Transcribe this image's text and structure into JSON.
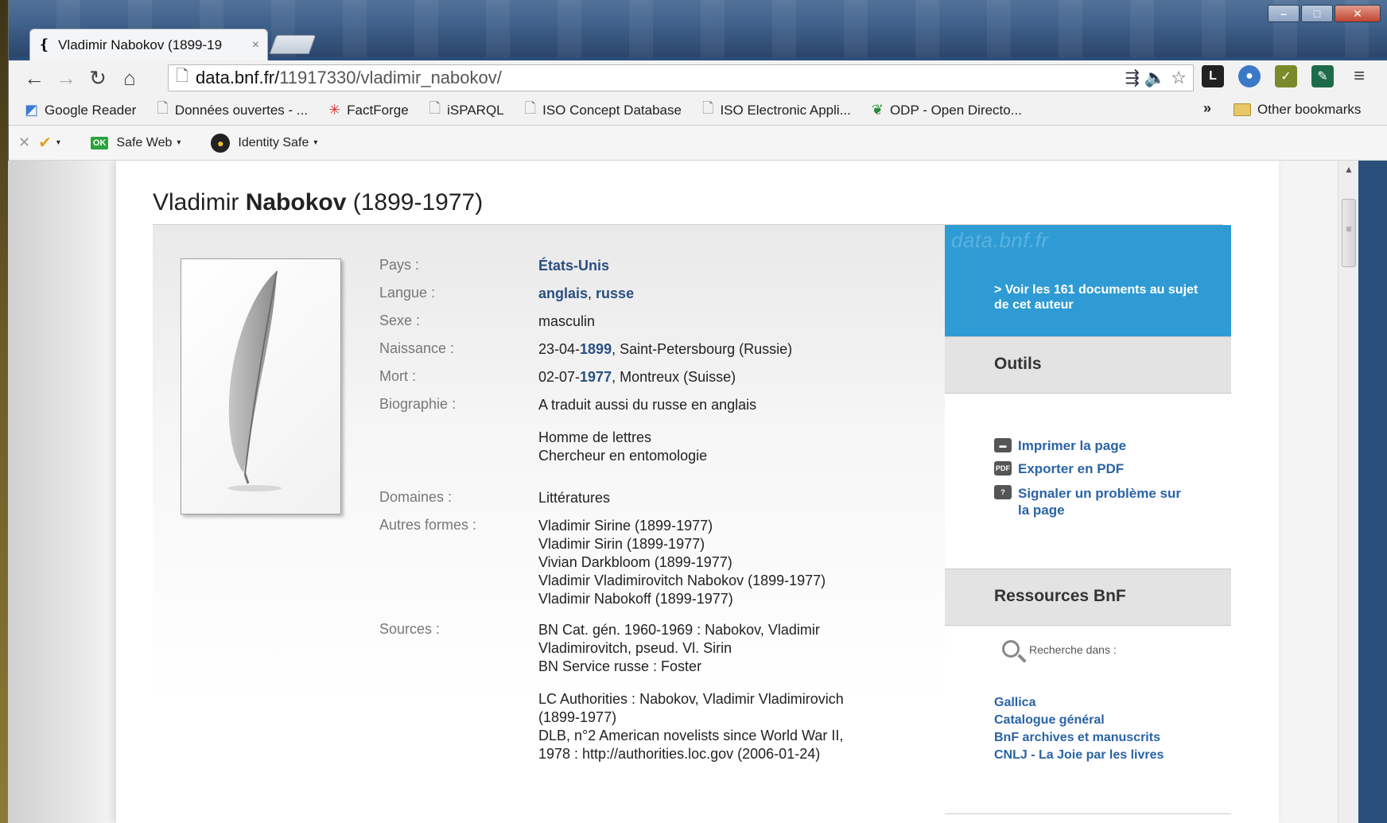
{
  "browser": {
    "tab_title": "Vladimir Nabokov (1899-19",
    "tab_close": "×",
    "url_host": "data.bnf.fr/",
    "url_path": "11917330/vladimir_nabokov/",
    "bookmarks": [
      {
        "label": "Google Reader",
        "icon": "google-icon"
      },
      {
        "label": "Données ouvertes - ...",
        "icon": "page-icon"
      },
      {
        "label": "FactForge",
        "icon": "factforge-icon"
      },
      {
        "label": "iSPARQL",
        "icon": "page-icon"
      },
      {
        "label": "ISO Concept Database",
        "icon": "page-icon"
      },
      {
        "label": "ISO Electronic Appli...",
        "icon": "page-icon"
      },
      {
        "label": "ODP - Open Directo...",
        "icon": "odp-icon"
      }
    ],
    "bookmarks_more": "»",
    "other_bookmarks": "Other bookmarks",
    "norton": {
      "safe_web": "Safe Web",
      "safe_web_badge": "OK",
      "identity_safe": "Identity Safe"
    }
  },
  "page": {
    "title_first": "Vladimir",
    "title_last": "Nabokov",
    "title_dates": "(1899-1977)",
    "fields": {
      "pays_label": "Pays :",
      "pays_value": "États-Unis",
      "langue_label": "Langue :",
      "langue_v1": "anglais",
      "langue_sep": ", ",
      "langue_v2": "russe",
      "sexe_label": "Sexe :",
      "sexe_value": "masculin",
      "naissance_label": "Naissance :",
      "naissance_day": "23-04-",
      "naissance_year": "1899",
      "naissance_place": ", Saint-Petersbourg (Russie)",
      "mort_label": "Mort :",
      "mort_day": "02-07-",
      "mort_year": "1977",
      "mort_place": ", Montreux (Suisse)",
      "bio_label": "Biographie :",
      "bio_line1": "A traduit aussi du russe en anglais",
      "bio_line2": "Homme de lettres",
      "bio_line3": "Chercheur en entomologie",
      "domaines_label": "Domaines :",
      "domaines_value": "Littératures",
      "autres_label": "Autres formes :",
      "autres": [
        "Vladimir Sirine (1899-1977)",
        "Vladimir Sirin (1899-1977)",
        "Vivian Darkbloom (1899-1977)",
        "Vladimir Vladimirovitch Nabokov (1899-1977)",
        "Vladimir Nabokoff (1899-1977)"
      ],
      "sources_label": "Sources :",
      "sources": [
        "BN Cat. gén. 1960-1969 : Nabokov, Vladimir",
        "Vladimirovitch, pseud. Vl. Sirin",
        "BN Service russe : Foster",
        "LC Authorities : Nabokov, Vladimir Vladimirovich",
        "(1899-1977)",
        "DLB, n°2 American novelists since World War II,",
        "1978 : http://authorities.loc.gov (2006-01-24)"
      ]
    }
  },
  "sidebar": {
    "logo": "data.bnf.fr",
    "promo_link": "> Voir les 161 documents au sujet de cet auteur",
    "outils_title": "Outils",
    "tools": [
      {
        "label": "Imprimer la page",
        "icon": "printer-icon"
      },
      {
        "label": "Exporter en PDF",
        "icon": "pdf-icon"
      },
      {
        "label": "Signaler un problème sur la page",
        "icon": "report-icon"
      }
    ],
    "ressources_title": "Ressources BnF",
    "recherche_label": "Recherche dans :",
    "resources": [
      "Gallica",
      "Catalogue général",
      "BnF archives et manuscrits",
      "CNLJ - La Joie par les livres"
    ]
  },
  "colors": {
    "accent_blue": "#2f9bd4",
    "link_blue": "#2a63a6",
    "title_bar": "#3a5d88"
  }
}
